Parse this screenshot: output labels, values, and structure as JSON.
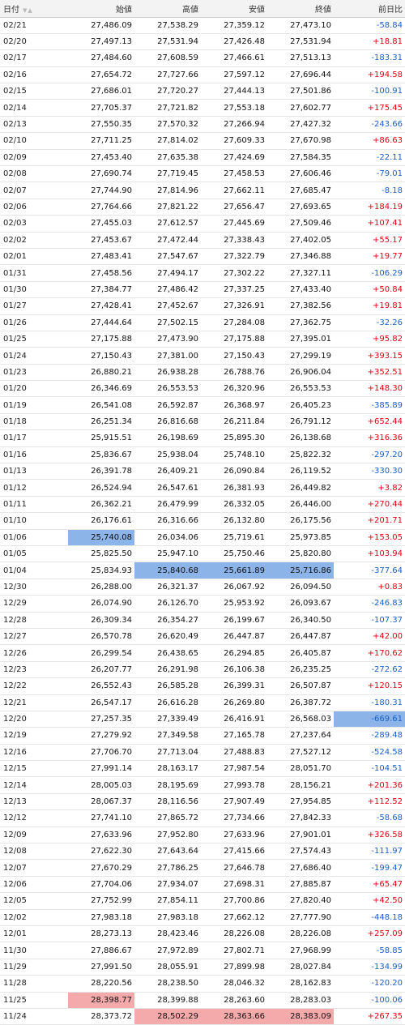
{
  "headers": [
    "日付",
    "始値",
    "高値",
    "安値",
    "終値",
    "前日比"
  ],
  "colors": {
    "up": "#e60012",
    "down": "#1a5fcc",
    "highlight_blue": "#8db4e8",
    "highlight_red": "#f4aaaa"
  },
  "rows": [
    {
      "date": "02/21",
      "open": "27,486.09",
      "high": "27,538.29",
      "low": "27,359.12",
      "close": "27,473.10",
      "change": "-58.84"
    },
    {
      "date": "02/20",
      "open": "27,497.13",
      "high": "27,531.94",
      "low": "27,426.48",
      "close": "27,531.94",
      "change": "+18.81"
    },
    {
      "date": "02/17",
      "open": "27,484.60",
      "high": "27,608.59",
      "low": "27,466.61",
      "close": "27,513.13",
      "change": "-183.31"
    },
    {
      "date": "02/16",
      "open": "27,654.72",
      "high": "27,727.66",
      "low": "27,597.12",
      "close": "27,696.44",
      "change": "+194.58"
    },
    {
      "date": "02/15",
      "open": "27,686.01",
      "high": "27,720.27",
      "low": "27,444.13",
      "close": "27,501.86",
      "change": "-100.91"
    },
    {
      "date": "02/14",
      "open": "27,705.37",
      "high": "27,721.82",
      "low": "27,553.18",
      "close": "27,602.77",
      "change": "+175.45"
    },
    {
      "date": "02/13",
      "open": "27,550.35",
      "high": "27,570.32",
      "low": "27,266.94",
      "close": "27,427.32",
      "change": "-243.66"
    },
    {
      "date": "02/10",
      "open": "27,711.25",
      "high": "27,814.02",
      "low": "27,609.33",
      "close": "27,670.98",
      "change": "+86.63"
    },
    {
      "date": "02/09",
      "open": "27,453.40",
      "high": "27,635.38",
      "low": "27,424.69",
      "close": "27,584.35",
      "change": "-22.11"
    },
    {
      "date": "02/08",
      "open": "27,690.74",
      "high": "27,719.45",
      "low": "27,458.53",
      "close": "27,606.46",
      "change": "-79.01"
    },
    {
      "date": "02/07",
      "open": "27,744.90",
      "high": "27,814.96",
      "low": "27,662.11",
      "close": "27,685.47",
      "change": "-8.18"
    },
    {
      "date": "02/06",
      "open": "27,764.66",
      "high": "27,821.22",
      "low": "27,656.47",
      "close": "27,693.65",
      "change": "+184.19"
    },
    {
      "date": "02/03",
      "open": "27,455.03",
      "high": "27,612.57",
      "low": "27,445.69",
      "close": "27,509.46",
      "change": "+107.41"
    },
    {
      "date": "02/02",
      "open": "27,453.67",
      "high": "27,472.44",
      "low": "27,338.43",
      "close": "27,402.05",
      "change": "+55.17"
    },
    {
      "date": "02/01",
      "open": "27,483.41",
      "high": "27,547.67",
      "low": "27,322.79",
      "close": "27,346.88",
      "change": "+19.77"
    },
    {
      "date": "01/31",
      "open": "27,458.56",
      "high": "27,494.17",
      "low": "27,302.22",
      "close": "27,327.11",
      "change": "-106.29"
    },
    {
      "date": "01/30",
      "open": "27,384.77",
      "high": "27,486.42",
      "low": "27,337.25",
      "close": "27,433.40",
      "change": "+50.84"
    },
    {
      "date": "01/27",
      "open": "27,428.41",
      "high": "27,452.67",
      "low": "27,326.91",
      "close": "27,382.56",
      "change": "+19.81"
    },
    {
      "date": "01/26",
      "open": "27,444.64",
      "high": "27,502.15",
      "low": "27,284.08",
      "close": "27,362.75",
      "change": "-32.26"
    },
    {
      "date": "01/25",
      "open": "27,175.88",
      "high": "27,473.90",
      "low": "27,175.88",
      "close": "27,395.01",
      "change": "+95.82"
    },
    {
      "date": "01/24",
      "open": "27,150.43",
      "high": "27,381.00",
      "low": "27,150.43",
      "close": "27,299.19",
      "change": "+393.15"
    },
    {
      "date": "01/23",
      "open": "26,880.21",
      "high": "26,938.28",
      "low": "26,788.76",
      "close": "26,906.04",
      "change": "+352.51"
    },
    {
      "date": "01/20",
      "open": "26,346.69",
      "high": "26,553.53",
      "low": "26,320.96",
      "close": "26,553.53",
      "change": "+148.30"
    },
    {
      "date": "01/19",
      "open": "26,541.08",
      "high": "26,592.87",
      "low": "26,368.97",
      "close": "26,405.23",
      "change": "-385.89"
    },
    {
      "date": "01/18",
      "open": "26,251.34",
      "high": "26,816.68",
      "low": "26,211.84",
      "close": "26,791.12",
      "change": "+652.44"
    },
    {
      "date": "01/17",
      "open": "25,915.51",
      "high": "26,198.69",
      "low": "25,895.30",
      "close": "26,138.68",
      "change": "+316.36"
    },
    {
      "date": "01/16",
      "open": "25,836.67",
      "high": "25,938.04",
      "low": "25,748.10",
      "close": "25,822.32",
      "change": "-297.20"
    },
    {
      "date": "01/13",
      "open": "26,391.78",
      "high": "26,409.21",
      "low": "26,090.84",
      "close": "26,119.52",
      "change": "-330.30"
    },
    {
      "date": "01/12",
      "open": "26,524.94",
      "high": "26,547.61",
      "low": "26,381.93",
      "close": "26,449.82",
      "change": "+3.82"
    },
    {
      "date": "01/11",
      "open": "26,362.21",
      "high": "26,479.99",
      "low": "26,332.05",
      "close": "26,446.00",
      "change": "+270.44"
    },
    {
      "date": "01/10",
      "open": "26,176.61",
      "high": "26,316.66",
      "low": "26,132.80",
      "close": "26,175.56",
      "change": "+201.71"
    },
    {
      "date": "01/06",
      "open": "25,740.08",
      "high": "26,034.06",
      "low": "25,719.61",
      "close": "25,973.85",
      "change": "+153.05"
    },
    {
      "date": "01/05",
      "open": "25,825.50",
      "high": "25,947.10",
      "low": "25,750.46",
      "close": "25,820.80",
      "change": "+103.94"
    },
    {
      "date": "01/04",
      "open": "25,834.93",
      "high": "25,840.68",
      "low": "25,661.89",
      "close": "25,716.86",
      "change": "-377.64"
    },
    {
      "date": "12/30",
      "open": "26,288.00",
      "high": "26,321.37",
      "low": "26,067.92",
      "close": "26,094.50",
      "change": "+0.83"
    },
    {
      "date": "12/29",
      "open": "26,074.90",
      "high": "26,126.70",
      "low": "25,953.92",
      "close": "26,093.67",
      "change": "-246.83"
    },
    {
      "date": "12/28",
      "open": "26,309.34",
      "high": "26,354.27",
      "low": "26,199.67",
      "close": "26,340.50",
      "change": "-107.37"
    },
    {
      "date": "12/27",
      "open": "26,570.78",
      "high": "26,620.49",
      "low": "26,447.87",
      "close": "26,447.87",
      "change": "+42.00"
    },
    {
      "date": "12/26",
      "open": "26,299.54",
      "high": "26,438.65",
      "low": "26,294.85",
      "close": "26,405.87",
      "change": "+170.62"
    },
    {
      "date": "12/23",
      "open": "26,207.77",
      "high": "26,291.98",
      "low": "26,106.38",
      "close": "26,235.25",
      "change": "-272.62"
    },
    {
      "date": "12/22",
      "open": "26,552.43",
      "high": "26,585.28",
      "low": "26,399.31",
      "close": "26,507.87",
      "change": "+120.15"
    },
    {
      "date": "12/21",
      "open": "26,547.17",
      "high": "26,616.28",
      "low": "26,269.80",
      "close": "26,387.72",
      "change": "-180.31"
    },
    {
      "date": "12/20",
      "open": "27,257.35",
      "high": "27,339.49",
      "low": "26,416.91",
      "close": "26,568.03",
      "change": "-669.61"
    },
    {
      "date": "12/19",
      "open": "27,279.92",
      "high": "27,349.58",
      "low": "27,165.78",
      "close": "27,237.64",
      "change": "-289.48"
    },
    {
      "date": "12/16",
      "open": "27,706.70",
      "high": "27,713.04",
      "low": "27,488.83",
      "close": "27,527.12",
      "change": "-524.58"
    },
    {
      "date": "12/15",
      "open": "27,991.14",
      "high": "28,163.17",
      "low": "27,987.54",
      "close": "28,051.70",
      "change": "-104.51"
    },
    {
      "date": "12/14",
      "open": "28,005.03",
      "high": "28,195.69",
      "low": "27,993.78",
      "close": "28,156.21",
      "change": "+201.36"
    },
    {
      "date": "12/13",
      "open": "28,067.37",
      "high": "28,116.56",
      "low": "27,907.49",
      "close": "27,954.85",
      "change": "+112.52"
    },
    {
      "date": "12/12",
      "open": "27,741.10",
      "high": "27,865.72",
      "low": "27,734.66",
      "close": "27,842.33",
      "change": "-58.68"
    },
    {
      "date": "12/09",
      "open": "27,633.96",
      "high": "27,952.80",
      "low": "27,633.96",
      "close": "27,901.01",
      "change": "+326.58"
    },
    {
      "date": "12/08",
      "open": "27,622.30",
      "high": "27,643.64",
      "low": "27,415.66",
      "close": "27,574.43",
      "change": "-111.97"
    },
    {
      "date": "12/07",
      "open": "27,670.29",
      "high": "27,786.25",
      "low": "27,646.78",
      "close": "27,686.40",
      "change": "-199.47"
    },
    {
      "date": "12/06",
      "open": "27,704.06",
      "high": "27,934.07",
      "low": "27,698.31",
      "close": "27,885.87",
      "change": "+65.47"
    },
    {
      "date": "12/05",
      "open": "27,752.99",
      "high": "27,854.11",
      "low": "27,700.86",
      "close": "27,820.40",
      "change": "+42.50"
    },
    {
      "date": "12/02",
      "open": "27,983.18",
      "high": "27,983.18",
      "low": "27,662.12",
      "close": "27,777.90",
      "change": "-448.18"
    },
    {
      "date": "12/01",
      "open": "28,273.13",
      "high": "28,423.46",
      "low": "28,226.08",
      "close": "28,226.08",
      "change": "+257.09"
    },
    {
      "date": "11/30",
      "open": "27,886.67",
      "high": "27,972.89",
      "low": "27,802.71",
      "close": "27,968.99",
      "change": "-58.85"
    },
    {
      "date": "11/29",
      "open": "27,991.50",
      "high": "28,055.91",
      "low": "27,899.98",
      "close": "28,027.84",
      "change": "-134.99"
    },
    {
      "date": "11/28",
      "open": "28,220.56",
      "high": "28,238.50",
      "low": "28,046.32",
      "close": "28,162.83",
      "change": "-120.20"
    },
    {
      "date": "11/25",
      "open": "28,398.77",
      "high": "28,399.88",
      "low": "28,263.60",
      "close": "28,283.03",
      "change": "-100.06"
    },
    {
      "date": "11/24",
      "open": "28,373.72",
      "high": "28,502.29",
      "low": "28,363.66",
      "close": "28,383.09",
      "change": "+267.35"
    }
  ]
}
